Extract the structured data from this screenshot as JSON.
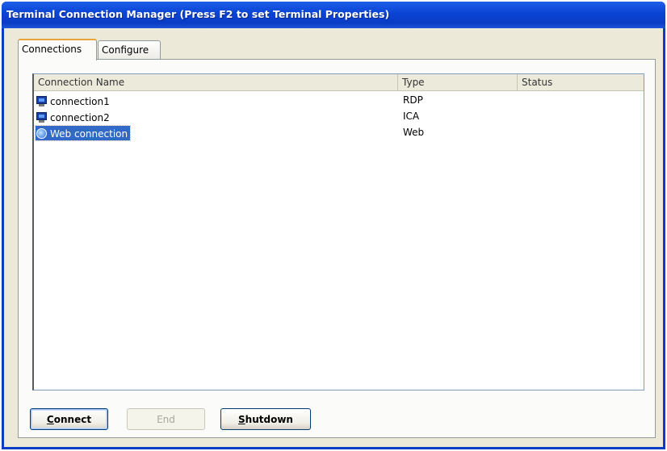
{
  "window": {
    "title": "Terminal Connection Manager (Press F2 to set Terminal Properties)"
  },
  "tabs": [
    {
      "label": "Connections",
      "active": true
    },
    {
      "label": "Configure",
      "active": false
    }
  ],
  "list": {
    "columns": [
      "Connection Name",
      "Type",
      "Status"
    ],
    "rows": [
      {
        "name": "connection1",
        "type": "RDP",
        "status": "",
        "icon": "terminal-icon",
        "selected": false
      },
      {
        "name": "connection2",
        "type": "ICA",
        "status": "",
        "icon": "terminal-icon",
        "selected": false
      },
      {
        "name": "Web connection",
        "type": "Web",
        "status": "",
        "icon": "web-icon",
        "selected": true
      }
    ]
  },
  "buttons": {
    "connect_first": "C",
    "connect_rest": "onnect",
    "end_first": "E",
    "end_rest": "nd",
    "shutdown_first": "S",
    "shutdown_rest": "hutdown"
  },
  "colors": {
    "titlebar": "#0a43d4",
    "selection": "#316ac5",
    "face": "#ece9d8"
  }
}
